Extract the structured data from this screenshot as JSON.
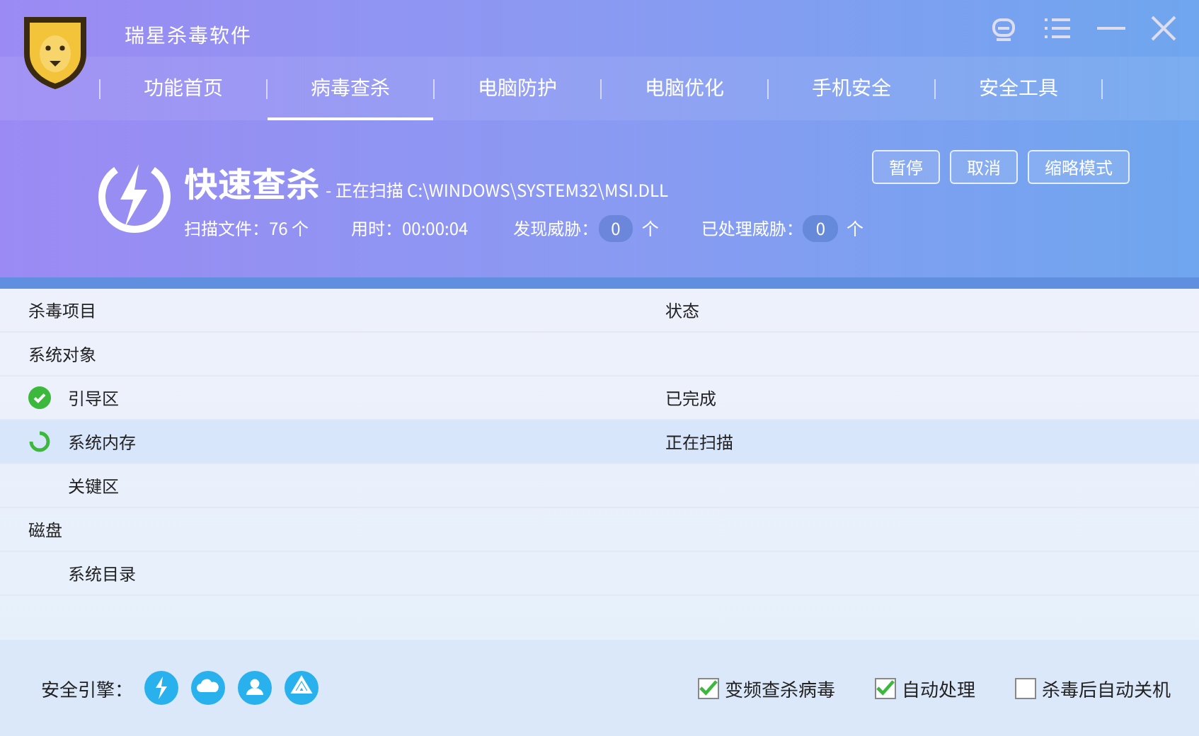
{
  "window": {
    "title": "瑞星杀毒软件"
  },
  "tabs": [
    {
      "label": "功能首页",
      "selected": false
    },
    {
      "label": "病毒查杀",
      "selected": true
    },
    {
      "label": "电脑防护",
      "selected": false
    },
    {
      "label": "电脑优化",
      "selected": false
    },
    {
      "label": "手机安全",
      "selected": false
    },
    {
      "label": "安全工具",
      "selected": false
    }
  ],
  "scan": {
    "title": "快速查杀",
    "current": "- 正在扫描 C:\\WINDOWS\\SYSTEM32\\MSI.DLL",
    "stats": [
      {
        "label": "扫描文件：76 个",
        "kind": "plain"
      },
      {
        "label": "用时：00:00:04",
        "kind": "plain"
      },
      {
        "label": "发现威胁：",
        "count": "0",
        "unit": "个",
        "kind": "count"
      },
      {
        "label": "已处理威胁：",
        "count": "0",
        "unit": "个",
        "kind": "count"
      }
    ],
    "buttons": [
      "暂停",
      "取消",
      "缩略模式"
    ]
  },
  "table": {
    "columns": [
      "杀毒项目",
      "状态"
    ],
    "groups": [
      {
        "name": "系统对象",
        "children": [
          {
            "name": "引导区",
            "status": "已完成",
            "kind": "done",
            "selected": false
          },
          {
            "name": "系统内存",
            "status": "正在扫描",
            "kind": "scanning",
            "selected": true
          },
          {
            "name": "关键区",
            "kind": "pending",
            "selected": false
          }
        ]
      },
      {
        "name": "磁盘",
        "children": [
          {
            "name": "系统目录",
            "kind": "pending",
            "selected": false
          }
        ]
      }
    ]
  },
  "footer": {
    "engine_label": "安全引擎：",
    "options": [
      {
        "label": "变频查杀病毒",
        "checked": true
      },
      {
        "label": "自动处理",
        "checked": true
      },
      {
        "label": "杀毒后自动关机",
        "checked": false
      }
    ]
  }
}
